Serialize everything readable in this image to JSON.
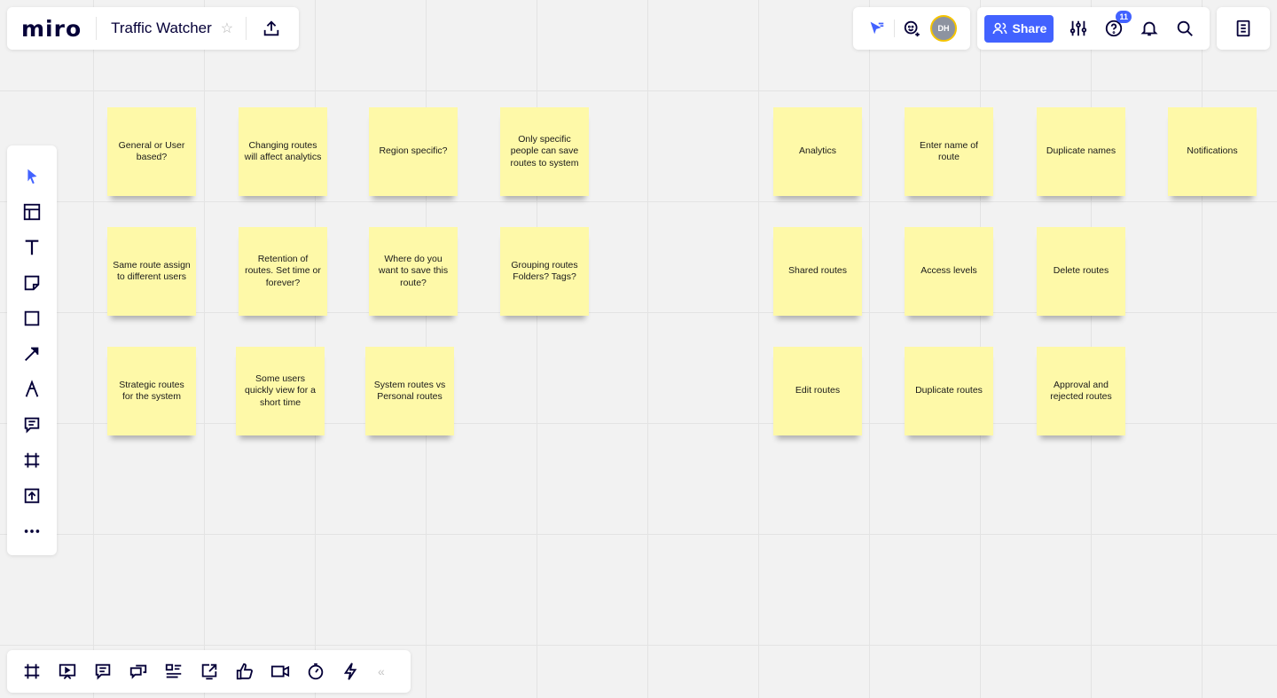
{
  "app": {
    "logo": "miro",
    "board_title": "Traffic Watcher"
  },
  "top_left": {
    "star_icon": "star-icon",
    "export_icon": "upload-icon"
  },
  "collaboration": {
    "avatar_initials": "DH"
  },
  "top_right": {
    "share_label": "Share",
    "help_badge": "11"
  },
  "accent_color": "#4262ff",
  "sticky_color": "#fef9a8",
  "sticky_notes": [
    {
      "text": "General or User based?"
    },
    {
      "text": "Changing routes will affect analytics"
    },
    {
      "text": "Region specific?"
    },
    {
      "text": "Only specific people can save routes to system"
    },
    {
      "text": "Same route assign to different users"
    },
    {
      "text": "Retention of routes. Set time or forever?"
    },
    {
      "text": "Where do you want to save this route?"
    },
    {
      "text": "Grouping routes Folders? Tags?"
    },
    {
      "text": "Strategic routes for the system"
    },
    {
      "text": "Some users quickly view for a short time"
    },
    {
      "text": "System routes vs Personal routes"
    },
    {
      "text": "Analytics"
    },
    {
      "text": "Enter name of route"
    },
    {
      "text": "Duplicate names"
    },
    {
      "text": "Notifications"
    },
    {
      "text": "Shared routes"
    },
    {
      "text": "Access levels"
    },
    {
      "text": "Delete routes"
    },
    {
      "text": "Edit routes"
    },
    {
      "text": "Duplicate routes"
    },
    {
      "text": "Approval and rejected routes"
    }
  ],
  "left_toolbar": [
    "select-icon",
    "templates-icon",
    "text-icon",
    "sticky-note-icon",
    "shape-icon",
    "arrow-icon",
    "pen-icon",
    "comment-icon",
    "frame-icon",
    "upload-icon",
    "more-icon"
  ],
  "bottom_toolbar": [
    "frames-icon",
    "presentation-icon",
    "comments-icon",
    "chat-icon",
    "card-icon",
    "share-screen-icon",
    "voting-icon",
    "video-icon",
    "timer-icon",
    "activity-icon"
  ],
  "bottom_collapse": "«"
}
